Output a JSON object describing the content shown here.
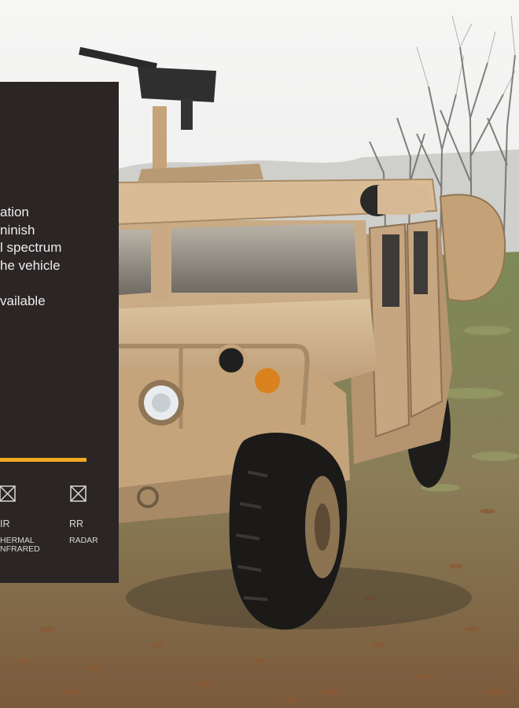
{
  "info_panel": {
    "body_lines": [
      "ation",
      "ninish",
      "l spectrum",
      "he vehicle",
      "",
      "vailable"
    ],
    "accent_color": "#f2a820",
    "signature_types": [
      {
        "code": "IR",
        "label_lines": [
          "HERMAL",
          "NFRARED"
        ],
        "icon": "crossed-box-icon"
      },
      {
        "code": "RR",
        "label_lines": [
          "RADAR"
        ],
        "icon": "crossed-box-icon"
      }
    ]
  },
  "photo": {
    "subject": "desert-tan armored utility vehicle with roof-mounted machine gun on grass field"
  }
}
